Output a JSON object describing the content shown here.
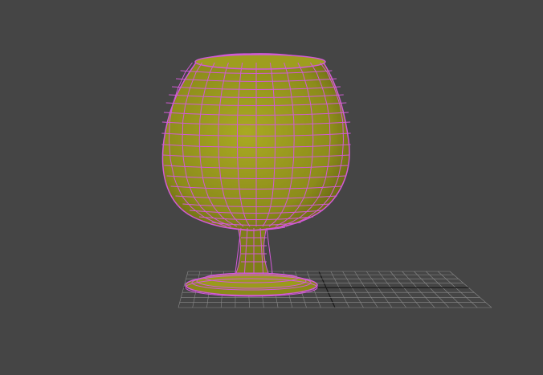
{
  "viewport": {
    "view": "perspective",
    "shading": "wireframe-over-shaded",
    "object": "brandy-snifter-glass",
    "colors": {
      "background": "#454545",
      "wireframe": "#d25ad6",
      "glass_fill": "#9a9a1c",
      "glass_shadow": "#6e6e14",
      "grid": "#8a8a8a",
      "grid_axis": "#1a1a1a"
    }
  }
}
